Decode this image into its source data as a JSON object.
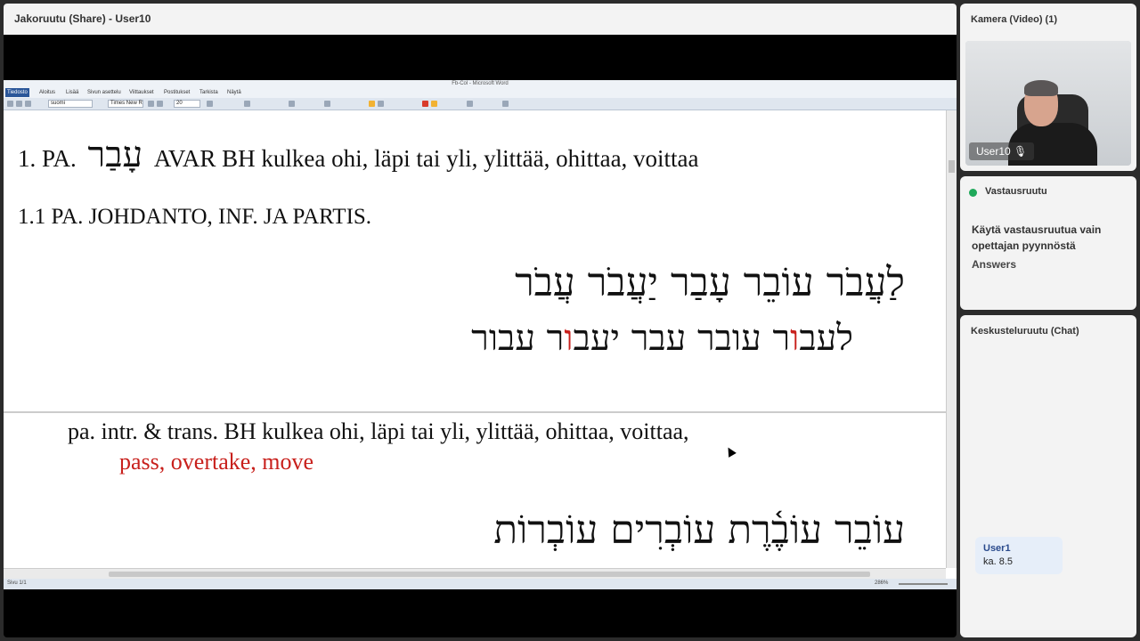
{
  "share": {
    "title": "Jakoruutu (Share) - User10",
    "word": {
      "window_title": "Fb-Col - Microsoft Word",
      "tabs": [
        "Tiedosto",
        "Aloitus",
        "Lisää",
        "Sivun asettelu",
        "Viittaukset",
        "Postitukset",
        "Tarkista",
        "Näytä"
      ],
      "language_value": "suomi",
      "font_value": "Times New R",
      "size_value": "20",
      "status_left": "Sivu 1/1",
      "zoom": "286%"
    },
    "doc": {
      "line1_prefix": "1. PA.",
      "line1_heb": "עָבַר",
      "line1_rest": "AVAR BH kulkea ohi, läpi tai yli, ylittää, ohittaa, voittaa",
      "line2": "1.1 PA. JOHDANTO, INF. JA PARTIS.",
      "heb_row1": "לַעֲבֹר עוֹבֵר עָבַר יַעֲבֹר עֲבֹר",
      "heb_row2_a": "לעב",
      "heb_row2_b": "ו",
      "heb_row2_c": "ר עובר עבר יעב",
      "heb_row2_d": "ו",
      "heb_row2_e": "ר עבור",
      "gloss_fi": "pa. intr. & trans. BH kulkea ohi, läpi tai yli, ylittää, ohittaa, voittaa,",
      "gloss_en": "pass, overtake, move",
      "heb_row3": "עוֹבֵר עוֹבֶ֫רֶת עוֹבְרִים עוֹבְרוֹת"
    }
  },
  "camera": {
    "title": "Kamera (Video) (1)",
    "participant": "User10"
  },
  "answers": {
    "title": "Vastausruutu",
    "instruction": "Käytä vastausruutua vain opettajan pyynnöstä",
    "label": "Answers"
  },
  "chat": {
    "title": "Keskusteluruutu (Chat)",
    "messages": [
      {
        "user": "User1",
        "text": "ka.  8.5"
      }
    ]
  }
}
